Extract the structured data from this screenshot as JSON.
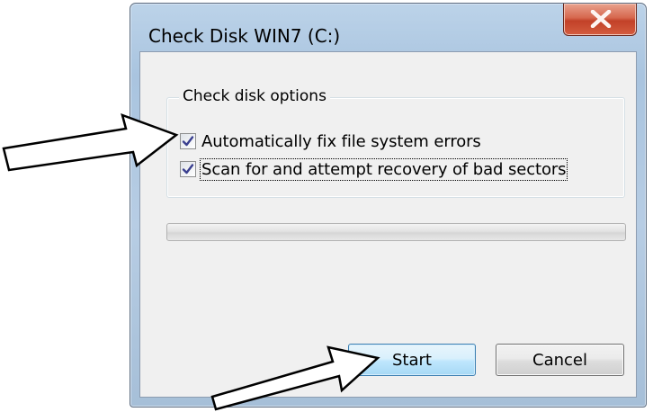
{
  "window": {
    "title": "Check Disk WIN7 (C:)",
    "close_icon": "close-x-icon"
  },
  "options_group": {
    "label": "Check disk options",
    "options": [
      {
        "label": "Automatically fix file system errors",
        "checked": true
      },
      {
        "label": "Scan for and attempt recovery of bad sectors",
        "checked": true
      }
    ]
  },
  "progress": {
    "value_percent": 0
  },
  "buttons": {
    "start_label": "Start",
    "cancel_label": "Cancel"
  },
  "annotations": {
    "arrow_icon": "callout-arrow-icon"
  },
  "colors": {
    "close_button": "#c8452c",
    "default_button_border": "#3c7fb1",
    "dialog_background": "#f0f0f0"
  }
}
